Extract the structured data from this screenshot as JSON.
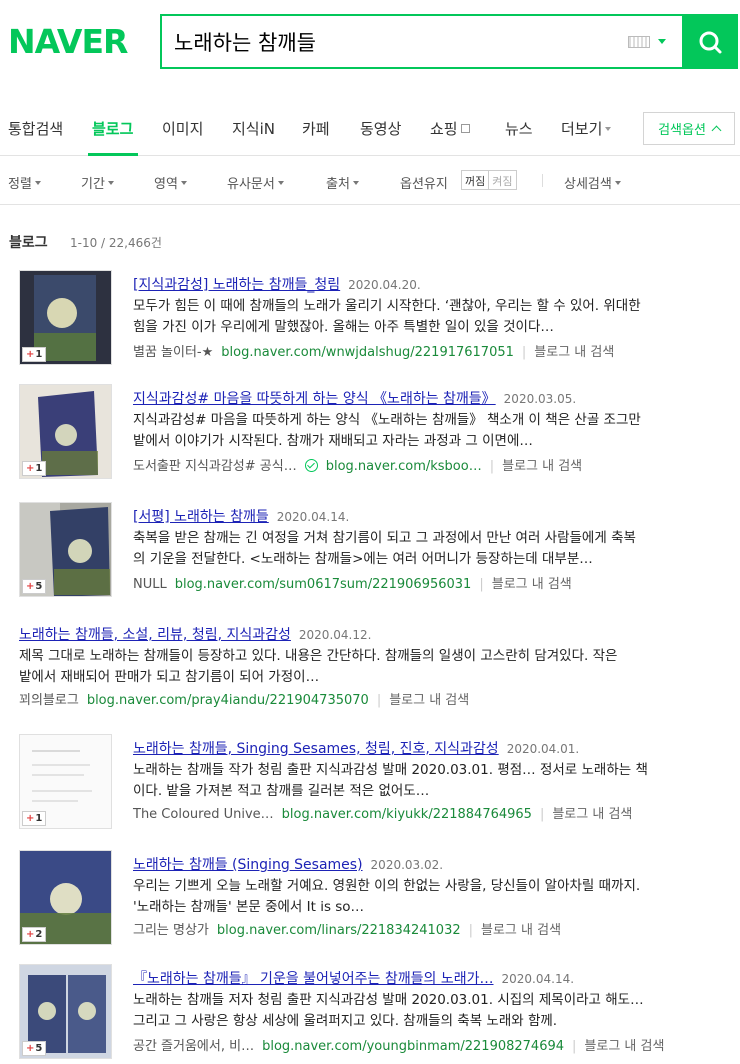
{
  "logo": "NAVER",
  "search": {
    "value": "노래하는 참깨들"
  },
  "tabs": [
    "통합검색",
    "블로그",
    "이미지",
    "지식iN",
    "카페",
    "동영상",
    "쇼핑",
    "뉴스",
    "더보기"
  ],
  "search_options_label": "검색옵션",
  "filters": [
    "정렬",
    "기간",
    "영역",
    "유사문서",
    "출처",
    "옵션유지",
    "상세검색"
  ],
  "toggle": {
    "on": "꺼짐",
    "off": "켜짐"
  },
  "results_header": {
    "title": "블로그",
    "count": "1-10 / 22,466건"
  },
  "in_blog_label": "블로그 내 검색",
  "colors": {
    "brand": "#03c75a",
    "link": "#1d23b6",
    "url": "#1a8a3a"
  },
  "results": [
    {
      "title": "[지식과감성] 노래하는 참깨들_청림",
      "date": "2020.04.20.",
      "desc1": "모두가 힘든 이 때에 참깨들의 노래가 울리기 시작한다. ‘괜찮아, 우리는 할 수 있어. 위대한",
      "desc2": "힘을 가진 이가 우리에게 말했잖아. 올해는 아주 특별한 일이 있을 것이다…",
      "source": "별꿈 놀이터-★",
      "url": "blog.naver.com/wnwjdalshug/221917617051",
      "badge": "1"
    },
    {
      "title": "지식과감성# 마음을 따뜻하게 하는 양식 《노래하는 참깨들》",
      "date": "2020.03.05.",
      "desc1": "지식과감성# 마음을 따뜻하게 하는 양식 《노래하는 참깨들》 책소개 이 책은 산골 조그만",
      "desc2": "밭에서 이야기가 시작된다. 참깨가 재배되고 자라는 과정과 그 이면에…",
      "source": "도서출판 지식과감성# 공식…",
      "url": "blog.naver.com/ksboo…",
      "badge": "1"
    },
    {
      "title": "[서평] 노래하는 참깨들",
      "date": "2020.04.14.",
      "desc1": "축복을 받은 참깨는 긴 여정을 거쳐 참기름이 되고 그 과정에서 만난 여러 사람들에게 축복",
      "desc2": "의 기운을 전달한다. <노래하는 참깨들>에는 여러 어머니가 등장하는데 대부분…",
      "source": "NULL",
      "url": "blog.naver.com/sum0617sum/221906956031",
      "badge": "5"
    },
    {
      "title": "노래하는 참깨들, 소설, 리뷰, 청림, 지식과감성",
      "date": "2020.04.12.",
      "desc1": "제목 그대로 노래하는 참깨들이 등장하고 있다. 내용은 간단하다. 참깨들의 일생이 고스란히 담겨있다. 작은",
      "desc2": "밭에서 재배되어 판매가 되고 참기름이 되어 가정이…",
      "source": "꾀의블로그",
      "url": "blog.naver.com/pray4iandu/221904735070"
    },
    {
      "title": "노래하는 참깨들, Singing Sesames, 청림, 진호, 지식과감성",
      "date": "2020.04.01.",
      "desc1": "노래하는 참깨들 작가 청림 출판 지식과감성 발매 2020.03.01. 평점… 정서로 노래하는 책",
      "desc2": "이다. 밭을 가져본 적고 참깨를 길러본 적은 없어도…",
      "source": "The Coloured Unive…",
      "url": "blog.naver.com/kiyukk/221884764965",
      "badge": "1"
    },
    {
      "title": "노래하는 참깨들 (Singing Sesames)",
      "date": "2020.03.02.",
      "desc1": "우리는 기쁘게 오늘 노래할 거예요. 영원한 이의 한없는 사랑을, 당신들이 알아차릴 때까지.",
      "desc2": "'노래하는 참깨들' 본문 중에서 It is so…",
      "source": "그리는 명상가",
      "url": "blog.naver.com/linars/221834241032",
      "badge": "2"
    },
    {
      "title": "『노래하는 참깨들』 기운을 불어넣어주는 참깨들의 노래가…",
      "date": "2020.04.14.",
      "desc1": "노래하는 참깨들 저자 청림 출판 지식과감성 발매 2020.03.01. 시집의 제목이라고 해도…",
      "desc2": "그리고 그 사랑은 항상 세상에 울려퍼지고 있다. 참깨들의 축복 노래와 함께.",
      "source": "공간 즐거움에서, 비…",
      "url": "blog.naver.com/youngbinmam/221908274694",
      "badge": "5"
    }
  ]
}
